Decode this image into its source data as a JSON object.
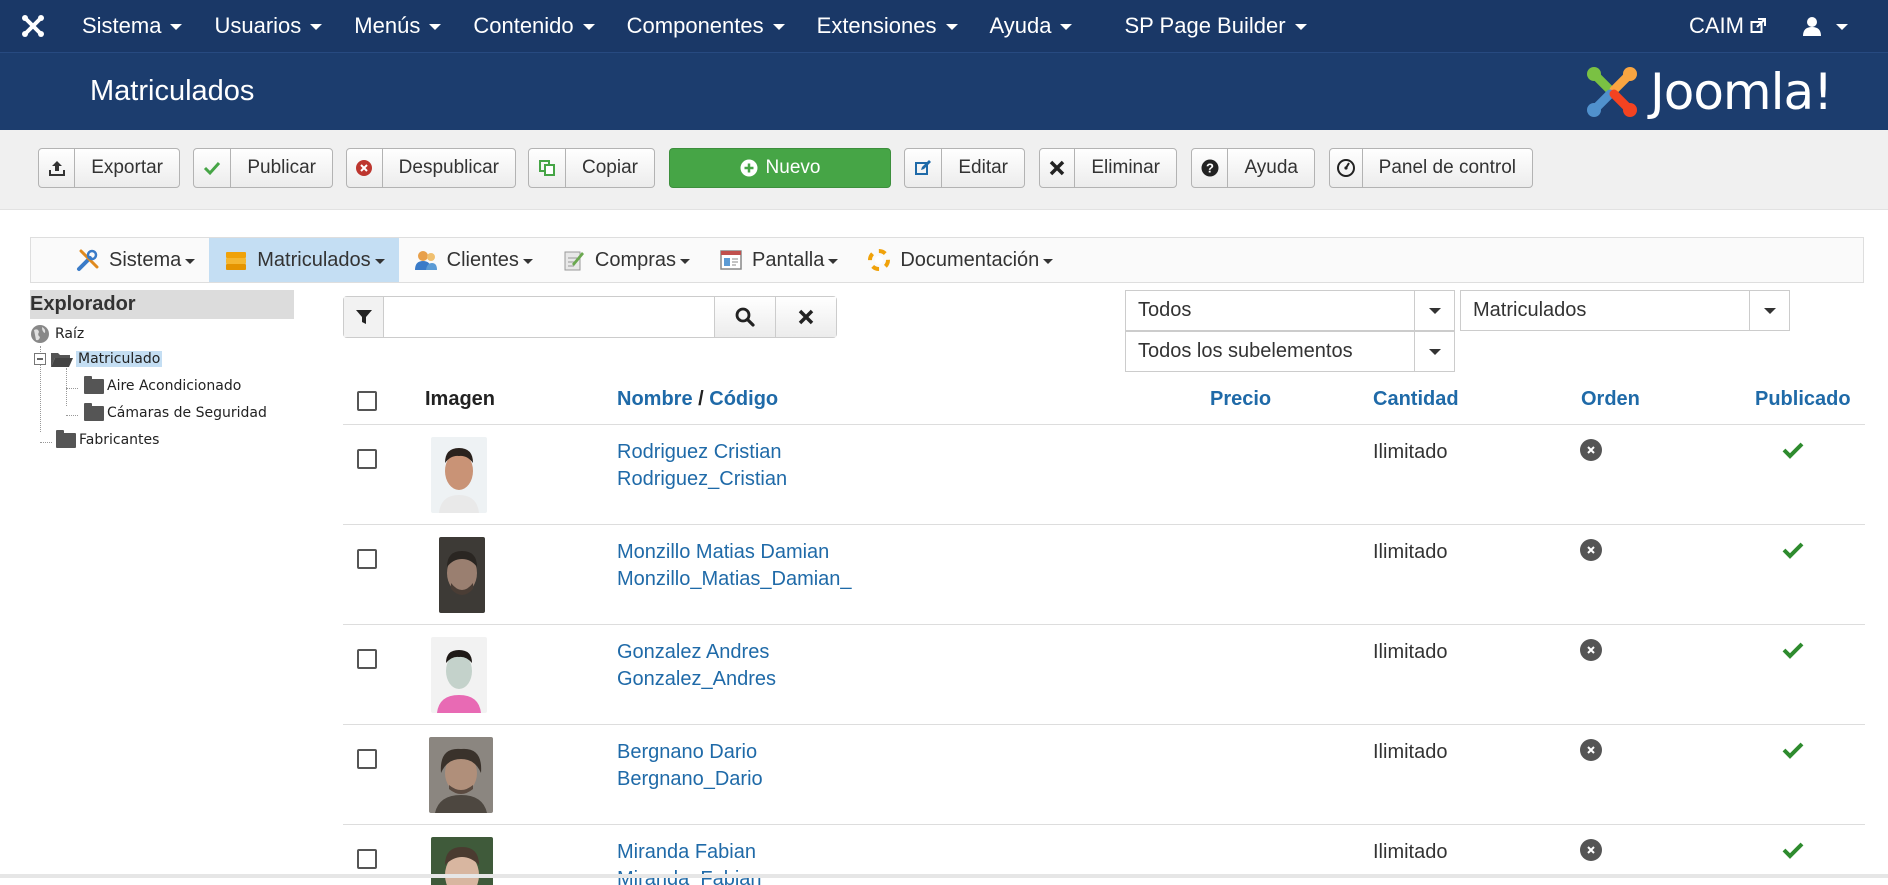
{
  "topnav": {
    "items": [
      "Sistema",
      "Usuarios",
      "Menús",
      "Contenido",
      "Componentes",
      "Extensiones",
      "Ayuda",
      "SP Page Builder"
    ],
    "site_label": "CAIM"
  },
  "header": {
    "title": "Matriculados",
    "brand": "Joomla!"
  },
  "toolbar": {
    "export": "Exportar",
    "publish": "Publicar",
    "unpublish": "Despublicar",
    "copy": "Copiar",
    "new": "Nuevo",
    "edit": "Editar",
    "delete": "Eliminar",
    "help": "Ayuda",
    "control_panel": "Panel de control"
  },
  "submenu": {
    "items": [
      "Sistema",
      "Matriculados",
      "Clientes",
      "Compras",
      "Pantalla",
      "Documentación"
    ]
  },
  "explorer": {
    "title": "Explorador",
    "root": "Raíz",
    "selected": "Matriculado",
    "children": [
      "Aire Acondicionado",
      "Cámaras de Seguridad"
    ],
    "other": "Fabricantes"
  },
  "search": {
    "value": "",
    "placeholder": ""
  },
  "filters": {
    "state": "Todos",
    "category": "Matriculados",
    "depth": "Todos los subelementos"
  },
  "table": {
    "col_image": "Imagen",
    "col_name": "Nombre",
    "col_sep": "/",
    "col_code": "Código",
    "col_price": "Precio",
    "col_qty": "Cantidad",
    "col_order": "Orden",
    "col_published": "Publicado",
    "rows": [
      {
        "name": "Rodriguez Cristian",
        "code": "Rodriguez_Cristian",
        "qty": "Ilimitado"
      },
      {
        "name": "Monzillo Matias Damian",
        "code": "Monzillo_Matias_Damian_",
        "qty": "Ilimitado"
      },
      {
        "name": "Gonzalez Andres",
        "code": "Gonzalez_Andres",
        "qty": "Ilimitado"
      },
      {
        "name": "Bergnano Dario",
        "code": "Bergnano_Dario",
        "qty": "Ilimitado"
      },
      {
        "name": "Miranda Fabian",
        "code": "Miranda_Fabian",
        "qty": "Ilimitado"
      }
    ]
  },
  "colors": {
    "navbar": "#1a3867",
    "header": "#1c3d6e",
    "link": "#1f6aa8",
    "success": "#46a546",
    "check": "#2e8b2e"
  }
}
